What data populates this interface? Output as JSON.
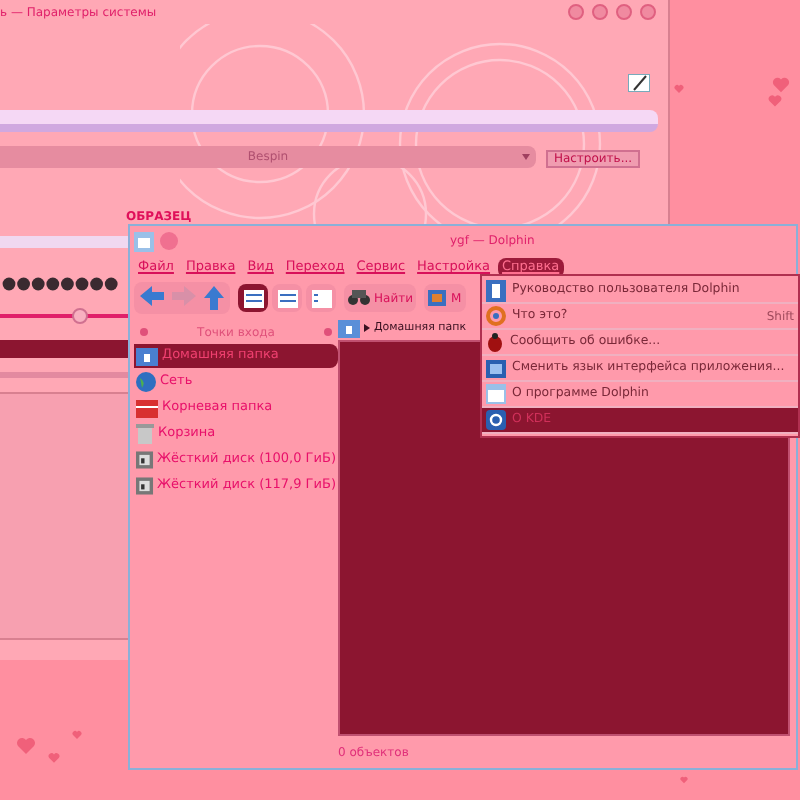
{
  "settings_window": {
    "title": "ь — Параметры системы",
    "style_combo": {
      "value": "Bespin"
    },
    "configure_button": "Настроить...",
    "preview_label": "ОБРАЗЕЦ"
  },
  "dolphin": {
    "title": "ygf — Dolphin",
    "menu": [
      {
        "label": "Файл",
        "selected": false
      },
      {
        "label": "Правка",
        "selected": false
      },
      {
        "label": "Вид",
        "selected": false
      },
      {
        "label": "Переход",
        "selected": false
      },
      {
        "label": "Сервис",
        "selected": false
      },
      {
        "label": "Настройка",
        "selected": false
      },
      {
        "label": "Справка",
        "selected": true
      }
    ],
    "toolbar": {
      "back_disabled": false,
      "forward_disabled": true,
      "views": [
        {
          "selected": true
        },
        {
          "selected": false
        },
        {
          "selected": false
        }
      ],
      "find": "Найти",
      "cut_button": "М"
    },
    "places": {
      "title": "Точки входа",
      "items": [
        {
          "label": "Домашняя папка",
          "selected": true,
          "kind": "home"
        },
        {
          "label": "Сеть",
          "selected": false,
          "kind": "network"
        },
        {
          "label": "Корневая папка",
          "selected": false,
          "kind": "root"
        },
        {
          "label": "Корзина",
          "selected": false,
          "kind": "trash"
        },
        {
          "label": "Жёсткий диск (100,0 ГиБ)",
          "selected": false,
          "kind": "disk"
        },
        {
          "label": "Жёсткий диск (117,9 ГиБ)",
          "selected": false,
          "kind": "disk"
        }
      ]
    },
    "breadcrumb": "Домашняя папк",
    "status": "0 объектов",
    "help_menu": [
      {
        "label": "Руководство пользователя Dolphin",
        "selected": false,
        "kind": "book"
      },
      {
        "label": "Что это?",
        "shortcut": "Shift",
        "selected": false,
        "kind": "whatsthis"
      },
      {
        "label": "Сообщить об ошибке...",
        "selected": false,
        "kind": "bug"
      },
      {
        "label": "Сменить язык интерфейса приложения...",
        "selected": false,
        "kind": "language"
      },
      {
        "label": "О программе Dolphin",
        "selected": false,
        "kind": "about"
      },
      {
        "label": "О KDE",
        "selected": true,
        "kind": "kde"
      }
    ]
  }
}
